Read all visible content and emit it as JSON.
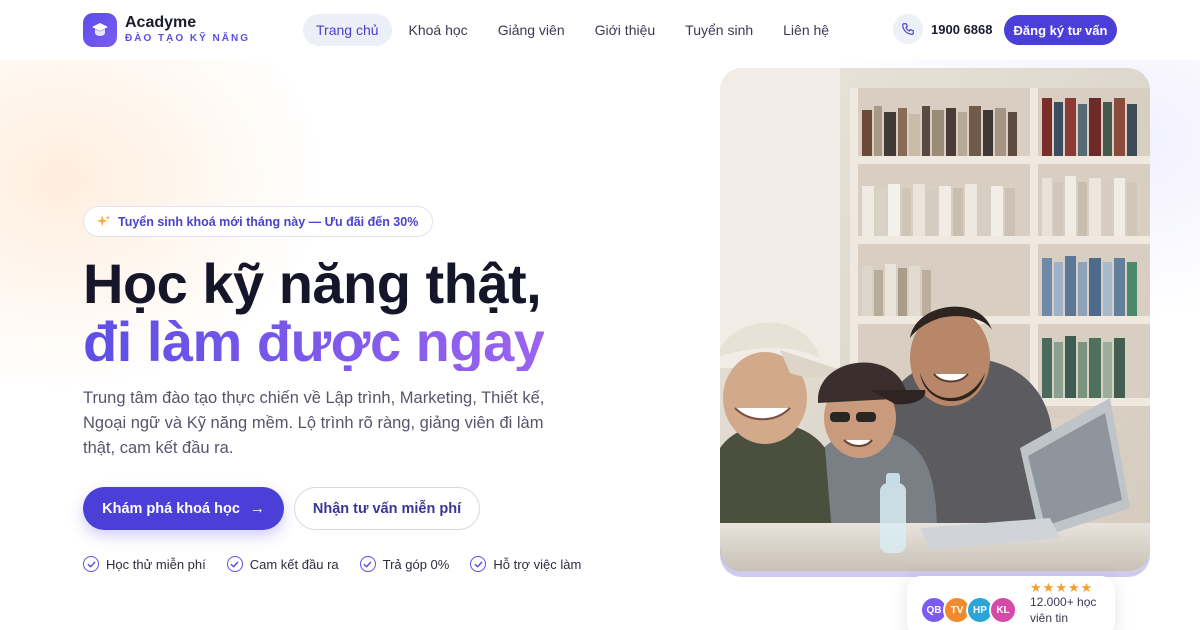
{
  "brand": {
    "name": "Acadyme",
    "tagline": "ĐÀO TẠO KỸ NĂNG",
    "logo_icon": "graduation-cap-icon",
    "accent_color": "#4a3fd6"
  },
  "nav": {
    "items": [
      {
        "label": "Trang chủ",
        "active": true
      },
      {
        "label": "Khoá học",
        "active": false
      },
      {
        "label": "Giảng viên",
        "active": false
      },
      {
        "label": "Giới thiệu",
        "active": false
      },
      {
        "label": "Tuyển sinh",
        "active": false
      },
      {
        "label": "Liên hệ",
        "active": false
      }
    ]
  },
  "contact": {
    "phone_icon": "phone-icon",
    "phone": "1900 6868",
    "cta_label": "Đăng ký tư vấn"
  },
  "hero": {
    "badge_icon": "sparkle-icon",
    "badge": "Tuyển sinh khoá mới tháng này — Ưu đãi đến 30%",
    "headline_line1": "Học kỹ năng thật,",
    "headline_line2": "đi làm được ngay",
    "lead": "Trung tâm đào tạo thực chiến về Lập trình, Marketing, Thiết kế, Ngoại ngữ và Kỹ năng mềm. Lộ trình rõ ràng, giảng viên đi làm thật, cam kết đầu ra.",
    "primary_button": "Khám phá khoá học",
    "primary_button_icon": "arrow-right-icon",
    "secondary_button": "Nhận tư vấn miễn phí",
    "features": [
      "Học thử miễn phí",
      "Cam kết đầu ra",
      "Trả góp 0%",
      "Hỗ trợ việc làm"
    ]
  },
  "rating": {
    "stars": 5,
    "text": "12.000+ học viên tin",
    "avatars": [
      {
        "initials": "QB",
        "color": "#7b5cf0"
      },
      {
        "initials": "TV",
        "color": "#f08a2d"
      },
      {
        "initials": "HP",
        "color": "#2aa5d6"
      },
      {
        "initials": "KL",
        "color": "#d64aa7"
      }
    ]
  }
}
